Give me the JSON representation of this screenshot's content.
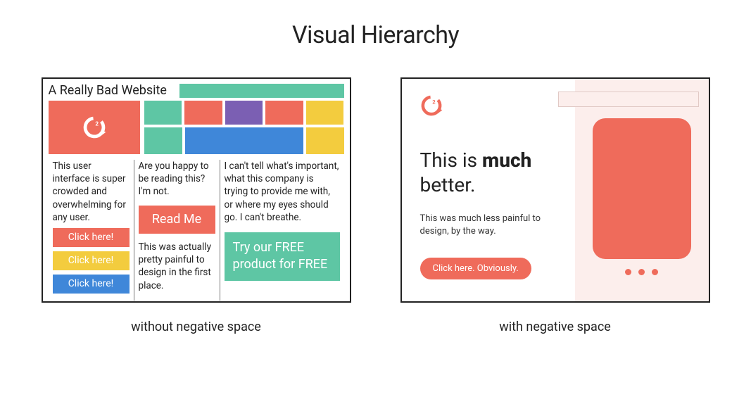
{
  "title": "Visual Hierarchy",
  "left": {
    "caption": "without negative space",
    "site_title": "A Really Bad Website",
    "col1": {
      "text": "This user interface is super crowded and overwhelming for any user.",
      "btn1": "Click here!",
      "btn2": "Click here!",
      "btn3": "Click here!"
    },
    "col2": {
      "text_top": "Are you happy to be reading this? I'm not.",
      "readme": "Read Me",
      "text_bottom": "This was actually pretty painful to design in the first place."
    },
    "col3": {
      "text": "I can't tell what's important, what this company is trying to provide me with, or where my eyes should go. I can't breathe.",
      "cta": "Try our FREE product for FREE"
    }
  },
  "right": {
    "caption": "with negative space",
    "heading_pre": "This is ",
    "heading_bold": "much",
    "heading_post": " better.",
    "sub": "This was much less painful to design, by the way.",
    "cta": "Click here. Obviously."
  }
}
